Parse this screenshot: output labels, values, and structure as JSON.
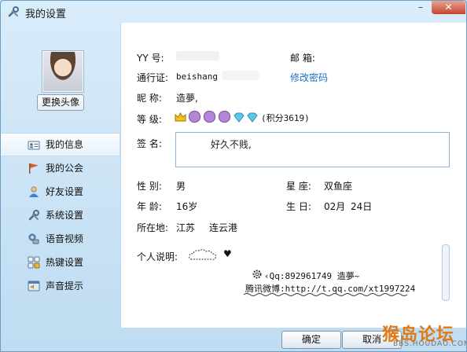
{
  "window": {
    "title": "我的设置",
    "controls": {
      "minimize": "–",
      "maximize": "□",
      "close": "✕"
    }
  },
  "sidebar": {
    "change_avatar": "更换头像",
    "items": [
      {
        "label": "我的信息",
        "icon": "id-card-icon",
        "active": true
      },
      {
        "label": "我的公会",
        "icon": "flag-icon",
        "active": false
      },
      {
        "label": "好友设置",
        "icon": "person-icon",
        "active": false
      },
      {
        "label": "系统设置",
        "icon": "wrench-icon",
        "active": false
      },
      {
        "label": "语音视频",
        "icon": "voice-video-icon",
        "active": false
      },
      {
        "label": "热键设置",
        "icon": "hotkey-icon",
        "active": false
      },
      {
        "label": "声音提示",
        "icon": "sound-icon",
        "active": false
      }
    ]
  },
  "profile": {
    "yy_label": "YY  号:",
    "yy_value": "",
    "email_label": "邮    箱:",
    "email_value": "",
    "passport_label": "通行证:",
    "passport_value": "beishang",
    "change_password": "修改密码",
    "nickname_label": "昵    称:",
    "nickname_value": "造夢,",
    "level_label": "等    级:",
    "points": "(积分3619)",
    "signature_label": "签    名:",
    "signature_value": "好久不贱,",
    "gender_label": "性    别:",
    "gender_value": "男",
    "zodiac_label": "星    座:",
    "zodiac_value": "双鱼座",
    "age_label": "年    龄:",
    "age_value": "16岁",
    "birthday_label": "生    日:",
    "birthday_month": "02月",
    "birthday_day": "24日",
    "location_label": "所在地:",
    "location_province": "江苏",
    "location_city": "连云港",
    "description_label": "个人说明:",
    "description_heart": "♥",
    "description_line1": "‹Qq:892961749   造夢~",
    "description_line2": "腾讯微博:http://t.qq.com/xt1997224"
  },
  "buttons": {
    "ok": "确定",
    "cancel": "取消"
  },
  "watermark": {
    "main": "猴岛论坛",
    "sub": "BBS.HOUDAO.COM"
  }
}
